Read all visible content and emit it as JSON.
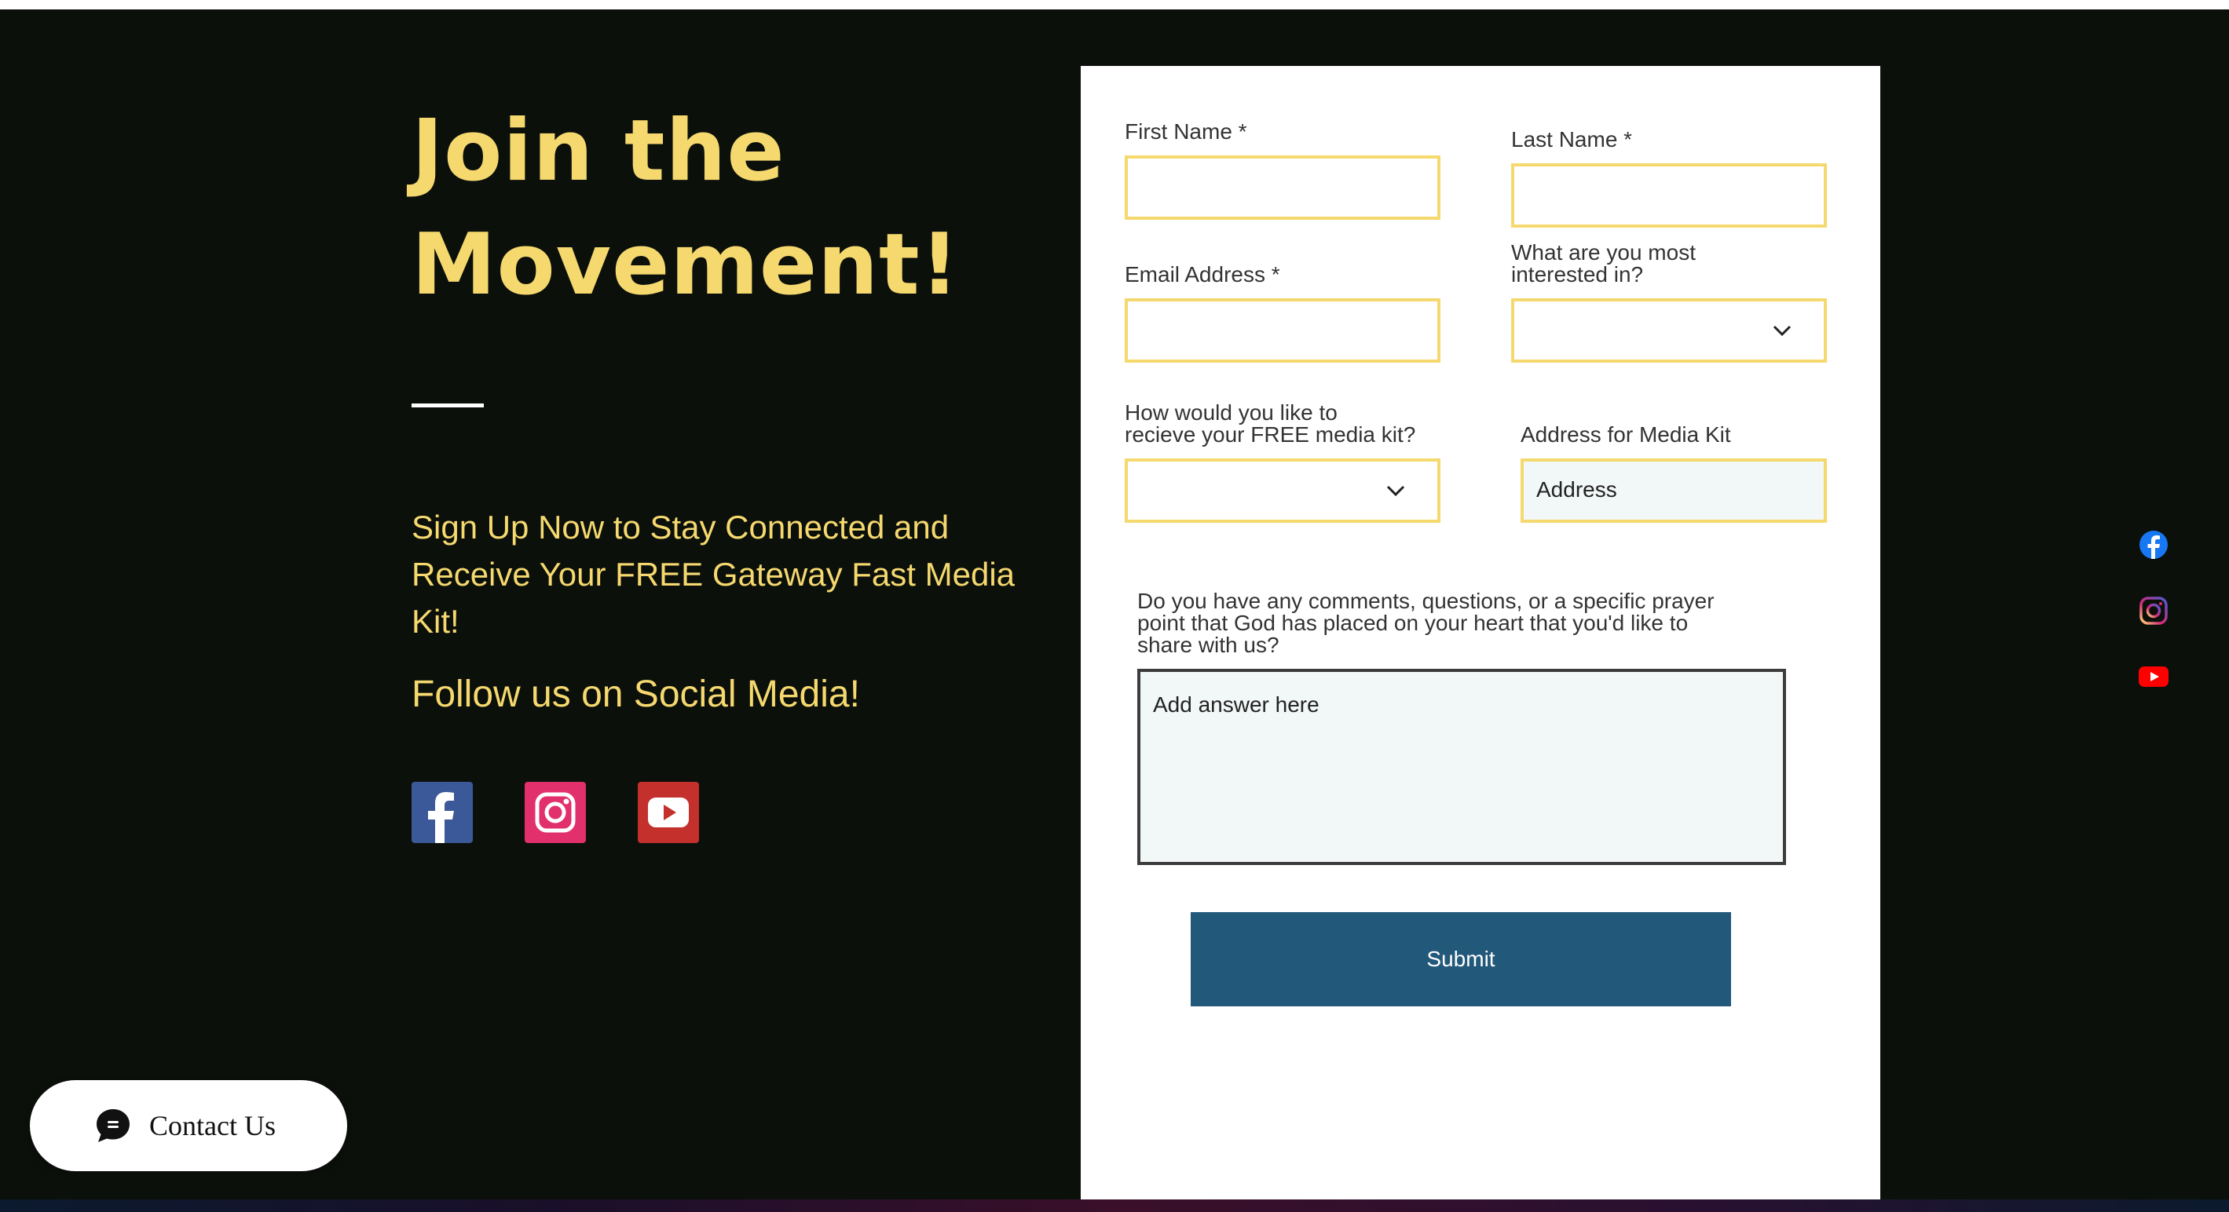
{
  "hero": {
    "title_line1": "Join the",
    "title_line2": "Movement!",
    "tagline": "Sign Up Now to Stay Connected and Receive Your FREE Gateway Fast Media Kit!",
    "follow_heading": "Follow us on Social Media!",
    "social_icons": [
      "facebook-icon",
      "instagram-icon",
      "youtube-icon"
    ]
  },
  "form": {
    "first_name_label": "First Name *",
    "last_name_label": "Last Name *",
    "email_label": "Email Address *",
    "interest_label_line1": "What are you most",
    "interest_label_line2": "interested in?",
    "delivery_label_line1": "How would you like to",
    "delivery_label_line2": "recieve your FREE media kit?",
    "address_label": "Address for Media Kit",
    "address_placeholder": "Address",
    "comments_label_line1": "Do you have any comments, questions, or a specific prayer",
    "comments_label_line2": "point that God has placed on your heart that you'd like to",
    "comments_label_line3": "share with us?",
    "comments_placeholder": "Add answer here",
    "submit_label": "Submit"
  },
  "side_social_icons": [
    "facebook-icon",
    "instagram-icon",
    "youtube-icon"
  ],
  "chat_widget": {
    "label": "Contact Us"
  },
  "colors": {
    "background": "#0c100b",
    "accent_yellow": "#f5d96f",
    "submit_blue": "#22587a",
    "field_border": "#f5d96f"
  }
}
